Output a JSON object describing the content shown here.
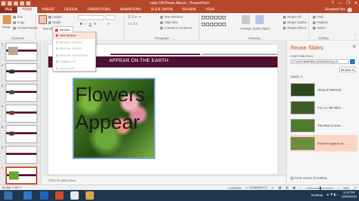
{
  "window": {
    "title": "Hats Off Photo Album - PowerPoint",
    "controls": [
      "?",
      "—",
      "❐",
      "✕"
    ],
    "user": "Elizabeth Nix"
  },
  "tabs": [
    "FILE",
    "HOME",
    "INSERT",
    "DESIGN",
    "TRANSITIONS",
    "ANIMATIONS",
    "SLIDE SHOW",
    "REVIEW",
    "VIEW"
  ],
  "active_tab": "HOME",
  "ribbon": {
    "clipboard": {
      "paste": "Paste",
      "cut": "Cut",
      "copy": "Copy",
      "format_painter": "Format Painter",
      "label": "Clipboard"
    },
    "slides": {
      "new_slide": "New Slide",
      "layout": "Layout",
      "reset": "Reset",
      "section": "Section"
    },
    "font": {
      "label": "Font"
    },
    "paragraph": {
      "text_direction": "Text Direction",
      "align_text": "Align Text",
      "convert_smartart": "Convert to SmartArt",
      "label": "Paragraph"
    },
    "drawing": {
      "quick_styles": "Quick Styles",
      "arrange": "Arrange",
      "shape_fill": "Shape Fill",
      "shape_outline": "Shape Outline",
      "shape_effects": "Shape Effects",
      "label": "Drawing"
    },
    "editing": {
      "find": "Find",
      "replace": "Replace",
      "select": "Select",
      "label": "Editing"
    }
  },
  "section_menu": {
    "header": "Section",
    "items": [
      {
        "label": "Add Section",
        "enabled": true
      },
      {
        "label": "Rename Section",
        "enabled": false
      },
      {
        "label": "Remove Section",
        "enabled": false
      },
      {
        "label": "Remove All Sections",
        "enabled": false
      },
      {
        "label": "Collapse All",
        "enabled": false
      },
      {
        "label": "Expand All",
        "enabled": false
      }
    ]
  },
  "thumbnails": [
    "1",
    "2",
    "3",
    "4",
    "5",
    "6",
    "7"
  ],
  "slide": {
    "title": "APPEAR ON THE EARTH",
    "photo_line1": "Flowers",
    "photo_line2": "Appear"
  },
  "notes_placeholder": "Click to add notes",
  "reuse_pane": {
    "title": "Reuse Slides",
    "insert_from": "Insert slide from:",
    "path": "C:\\Users\\Beth\\Documents\\Song of…",
    "browse": "Browse",
    "slides_label": "Slides: 4",
    "slides": [
      {
        "name": "Song of Solomon",
        "color": "#2c4a1c"
      },
      {
        "name": "For, Lo, the Wint…",
        "color": "#3e5e27"
      },
      {
        "name": "The Rain is Over …",
        "color": "#4d7b2b"
      },
      {
        "name": "Flowers Appear on…",
        "color": "#6d8e3a"
      }
    ],
    "keep_source": "Keep source formatting"
  },
  "status": {
    "slide_info": "SLIDE 7 OF 7",
    "notes": "NOTES",
    "comments": "COMMENTS",
    "zoom": "60%"
  },
  "taskbar": {
    "desktop": "Desktop",
    "time": "5:12 PM",
    "date": "10/26/2013"
  }
}
